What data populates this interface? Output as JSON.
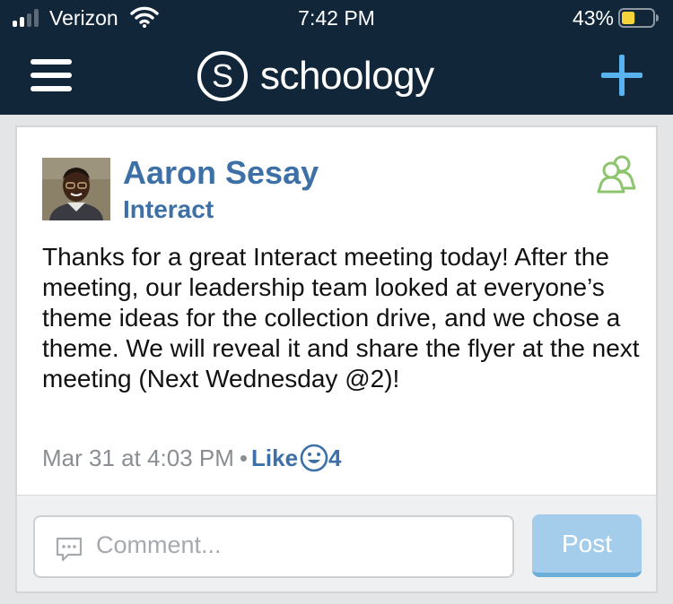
{
  "status_bar": {
    "carrier": "Verizon",
    "time": "7:42 PM",
    "battery_percent": "43%",
    "battery_level": 0.43,
    "signal_bars": 2
  },
  "nav": {
    "logo_letter": "S",
    "logo_text": "schoology",
    "menu_icon": "hamburger-menu-icon",
    "add_icon": "plus-icon"
  },
  "post": {
    "author": "Aaron Sesay",
    "group": "Interact",
    "group_icon": "group-members-icon",
    "body": "Thanks for a great Interact meeting today! After the meeting, our leadership team looked at everyone’s theme ideas for the collection drive, and we chose a theme. We will reveal it and share the flyer at the next meeting (Next Wednesday @2)!",
    "date": "Mar 31 at 4:03 PM",
    "separator": "•",
    "like_label": "Like",
    "like_icon": "smiley-icon",
    "like_count": "4"
  },
  "comment": {
    "placeholder": "Comment...",
    "icon": "speech-bubble-icon",
    "post_label": "Post"
  },
  "colors": {
    "header_bg": "#112639",
    "link_blue": "#3c70a6",
    "accent_blue": "#59b3ee",
    "group_icon_green": "#8cc56d",
    "post_button": "#a4cdeb"
  }
}
